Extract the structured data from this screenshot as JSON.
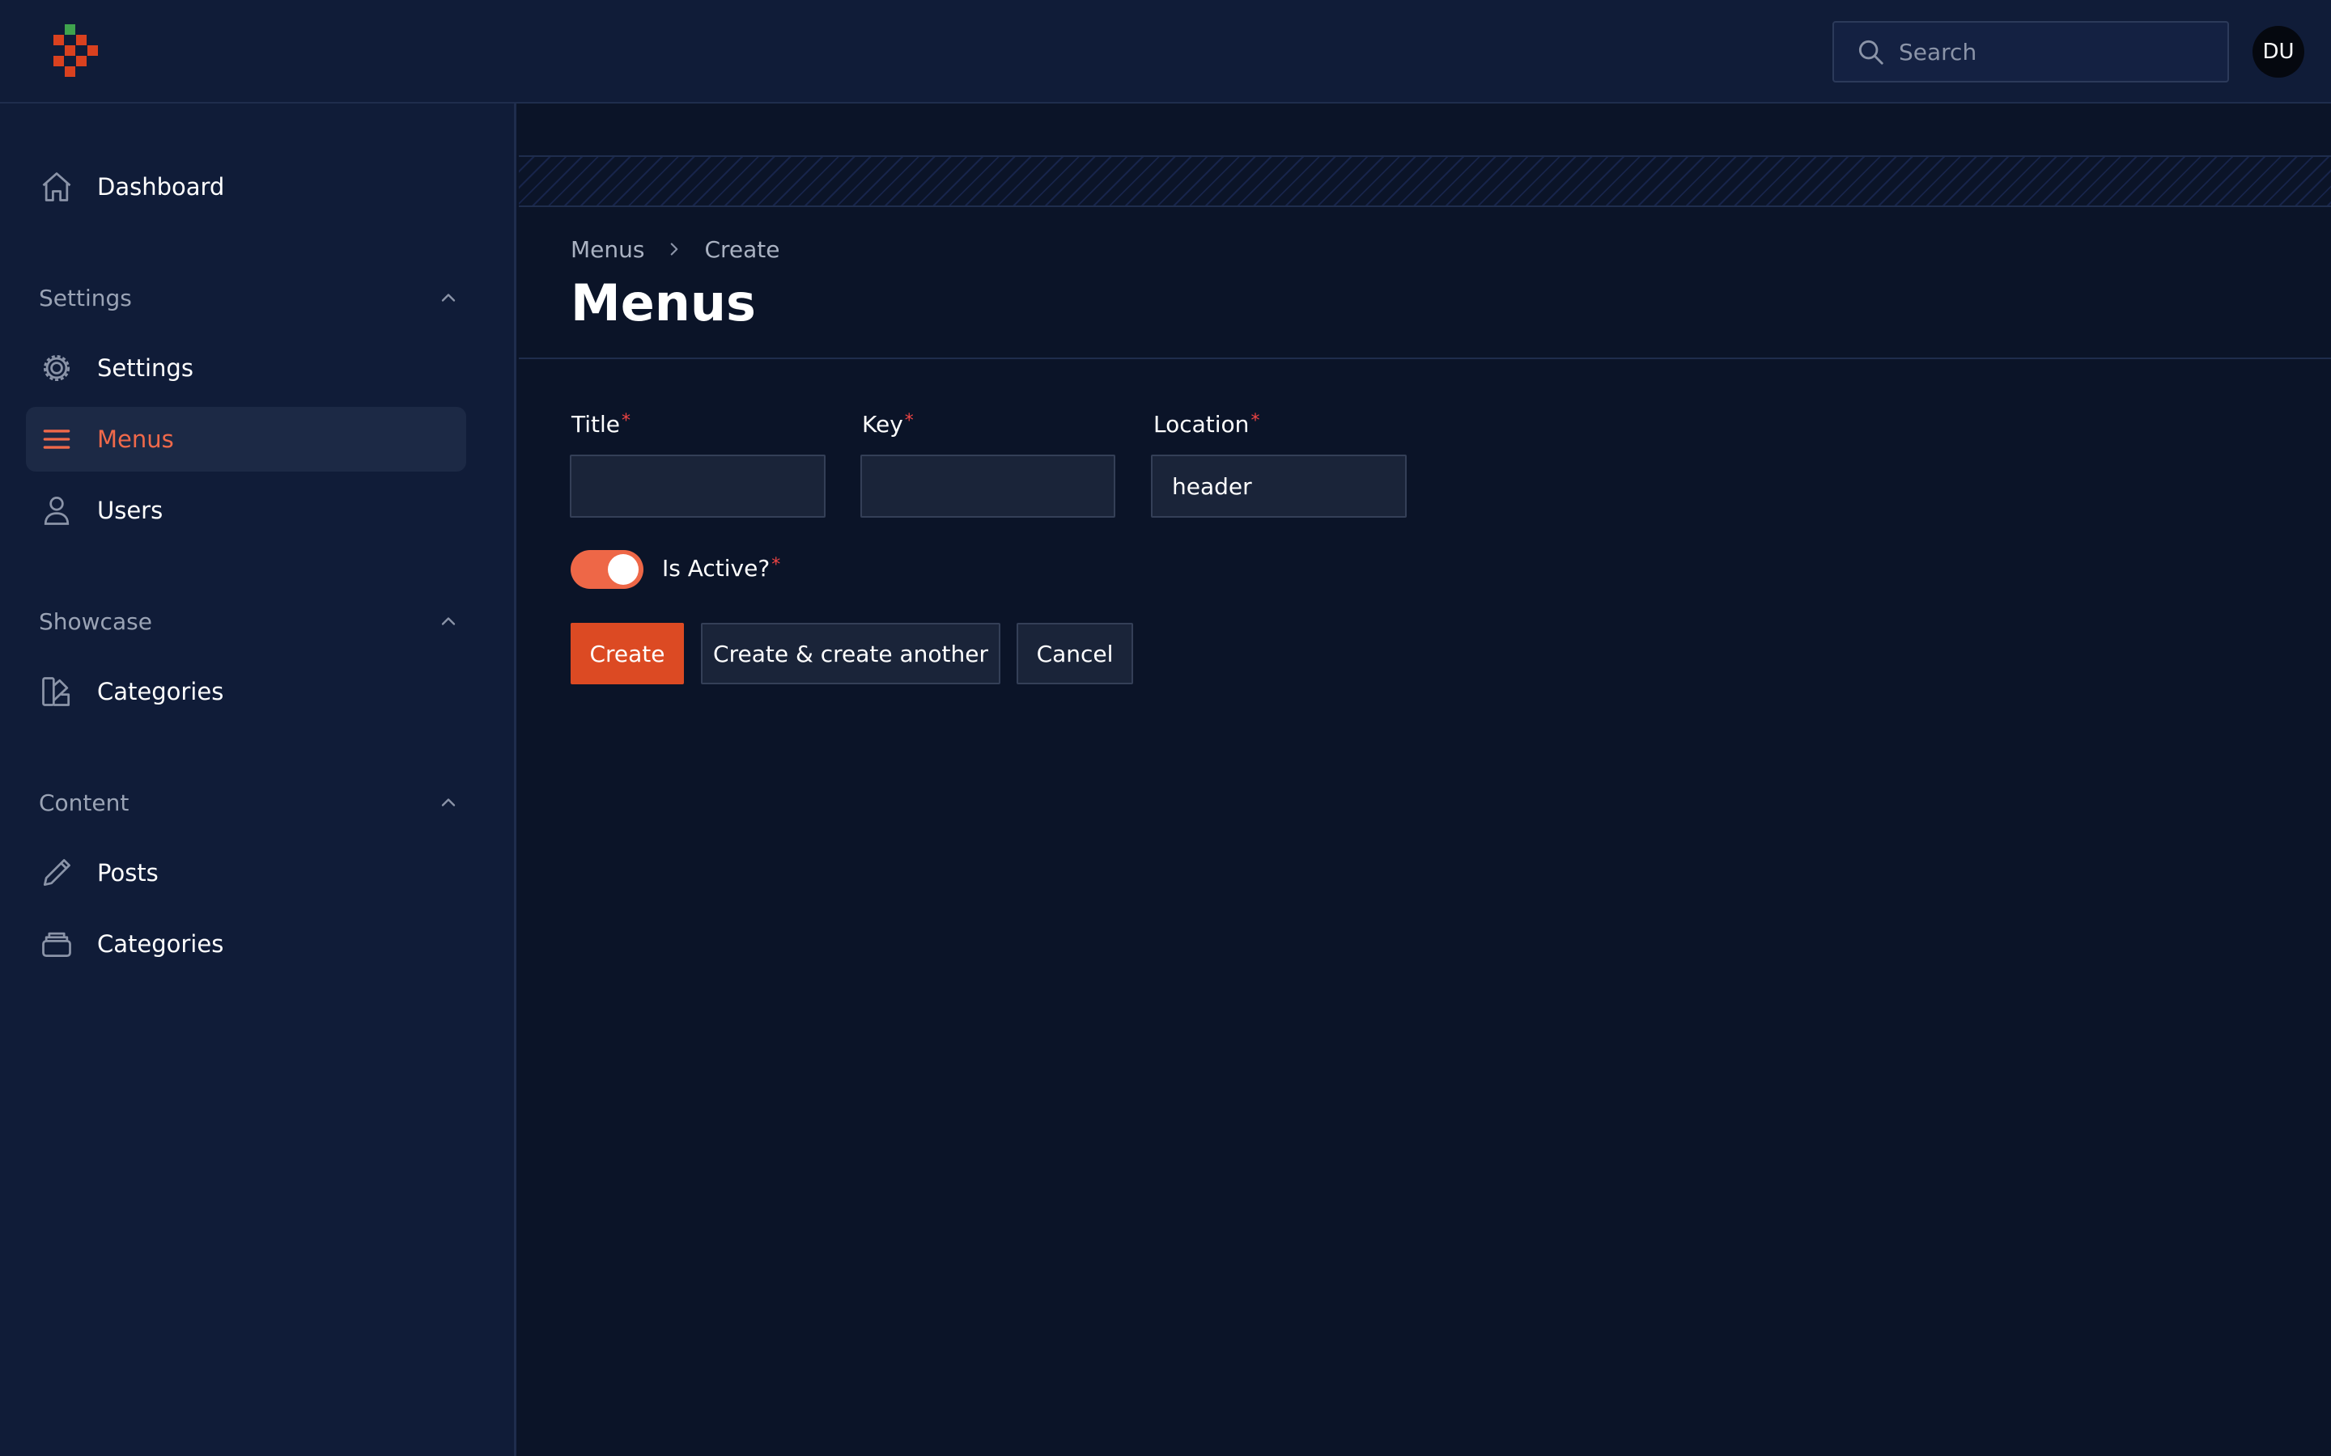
{
  "topbar": {
    "search_placeholder": "Search",
    "avatar_initials": "DU"
  },
  "sidebar": {
    "dashboard": "Dashboard",
    "groups": [
      {
        "label": "Settings",
        "items": [
          {
            "label": "Settings",
            "icon": "gear-icon"
          },
          {
            "label": "Menus",
            "icon": "menu-bars-icon",
            "active": true
          },
          {
            "label": "Users",
            "icon": "user-icon"
          }
        ]
      },
      {
        "label": "Showcase",
        "items": [
          {
            "label": "Categories",
            "icon": "swatch-icon"
          }
        ]
      },
      {
        "label": "Content",
        "items": [
          {
            "label": "Posts",
            "icon": "pencil-icon"
          },
          {
            "label": "Categories",
            "icon": "folder-stack-icon"
          }
        ]
      }
    ]
  },
  "breadcrumb": {
    "parent": "Menus",
    "current": "Create"
  },
  "page": {
    "title": "Menus"
  },
  "form": {
    "title": {
      "label": "Title",
      "required": "*",
      "value": ""
    },
    "key": {
      "label": "Key",
      "required": "*",
      "value": ""
    },
    "location": {
      "label": "Location",
      "required": "*",
      "value": "header"
    },
    "is_active": {
      "label": "Is Active?",
      "required": "*",
      "on": true
    }
  },
  "actions": {
    "create": "Create",
    "create_another": "Create & create another",
    "cancel": "Cancel"
  },
  "colors": {
    "accent": "#dc4a23",
    "active_text": "#f0694a",
    "background": "#0b1428",
    "sidebar": "#101c38"
  }
}
